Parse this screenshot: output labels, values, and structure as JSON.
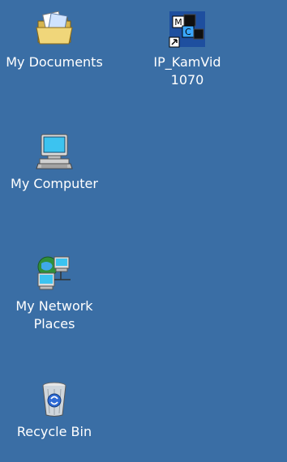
{
  "desktop": {
    "background_color": "#3a6ea5",
    "icons": [
      {
        "label": "My Documents",
        "icon": "folder-documents-icon"
      },
      {
        "label": "IP_KamVid\n1070",
        "icon": "kamvid-shortcut-icon"
      },
      {
        "label": "My Computer",
        "icon": "computer-icon"
      },
      {
        "label": "My Network\nPlaces",
        "icon": "network-places-icon"
      },
      {
        "label": "Recycle Bin",
        "icon": "recycle-bin-icon"
      }
    ]
  }
}
